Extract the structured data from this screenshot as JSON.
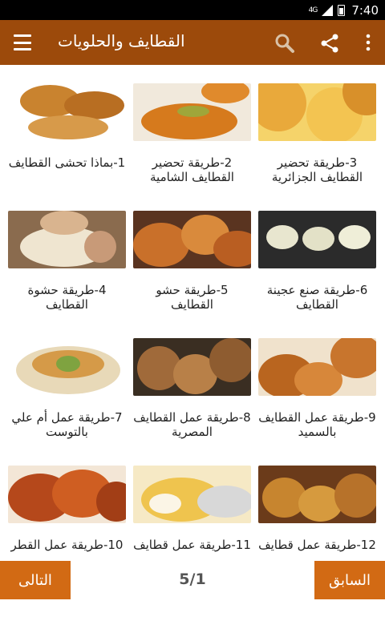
{
  "status": {
    "network": "4G",
    "time": "7:40"
  },
  "appbar": {
    "title": "القطايف والحلويات",
    "menu_icon": "menu-icon",
    "search_icon": "search-icon",
    "share_icon": "share-icon",
    "more_icon": "more-vert-icon"
  },
  "items": [
    {
      "label": "3-طريقة تحضير القطايف الجزائرية"
    },
    {
      "label": "2-طريقة تحضير القطايف الشامية"
    },
    {
      "label": "1-بماذا تحشى القطايف"
    },
    {
      "label": "6-طريقة صنع عجينة القطايف"
    },
    {
      "label": "5-طريقة حشو القطايف"
    },
    {
      "label": "4-طريقة حشوة القطايف"
    },
    {
      "label": "9-طريقة عمل القطايف بالسميد"
    },
    {
      "label": "8-طريقة عمل القطايف المصرية"
    },
    {
      "label": "7-طريقة عمل أم علي بالتوست"
    },
    {
      "label": "12-طريقة عمل قطايف"
    },
    {
      "label": "11-طريقة عمل قطايف"
    },
    {
      "label": "10-طريقة عمل القطر"
    }
  ],
  "footer": {
    "next_label": "التالى",
    "prev_label": "السابق",
    "page_indicator": "5/1"
  },
  "colors": {
    "appbar": "#9c4a0b",
    "button": "#d26a14"
  }
}
